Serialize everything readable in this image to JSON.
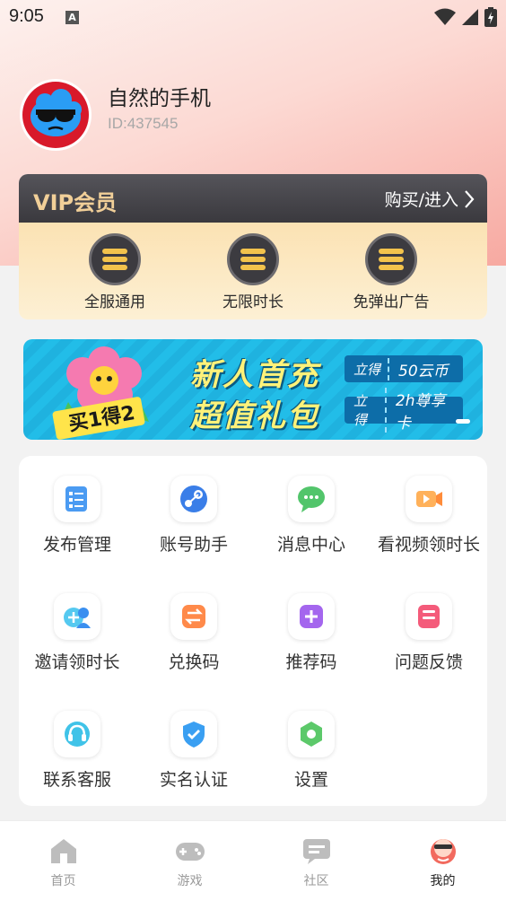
{
  "status_bar": {
    "time": "9:05",
    "notification_badge": "A"
  },
  "profile": {
    "name": "自然的手机",
    "id": "ID:437545"
  },
  "vip": {
    "title": "VIP会员",
    "enter_label": "购买/进入",
    "benefits": [
      {
        "label": "全服通用"
      },
      {
        "label": "无限时长"
      },
      {
        "label": "免弹出广告"
      }
    ]
  },
  "banner": {
    "title_line1": "新人首充",
    "title_line2": "超值礼包",
    "sticker": "买1得2",
    "tags": [
      {
        "prefix": "立得",
        "gain": "50云币"
      },
      {
        "prefix": "立得",
        "gain": "2h尊享卡"
      }
    ]
  },
  "features": [
    {
      "label": "发布管理",
      "icon": "checklist-icon"
    },
    {
      "label": "账号助手",
      "icon": "steam-icon"
    },
    {
      "label": "消息中心",
      "icon": "chat-icon"
    },
    {
      "label": "看视频领时长",
      "icon": "video-icon"
    },
    {
      "label": "邀请领时长",
      "icon": "invite-icon"
    },
    {
      "label": "兑换码",
      "icon": "exchange-icon"
    },
    {
      "label": "推荐码",
      "icon": "plus-icon"
    },
    {
      "label": "问题反馈",
      "icon": "feedback-icon"
    },
    {
      "label": "联系客服",
      "icon": "headset-icon"
    },
    {
      "label": "实名认证",
      "icon": "shield-check-icon"
    },
    {
      "label": "设置",
      "icon": "settings-icon"
    }
  ],
  "tabbar": [
    {
      "label": "首页",
      "icon": "home-icon",
      "active": false
    },
    {
      "label": "游戏",
      "icon": "gamepad-icon",
      "active": false
    },
    {
      "label": "社区",
      "icon": "community-icon",
      "active": false
    },
    {
      "label": "我的",
      "icon": "profile-icon",
      "active": true
    }
  ],
  "colors": {
    "vip_gold": "#f1cf98",
    "banner_blue": "#22bde8",
    "active_tab": "#222222"
  }
}
